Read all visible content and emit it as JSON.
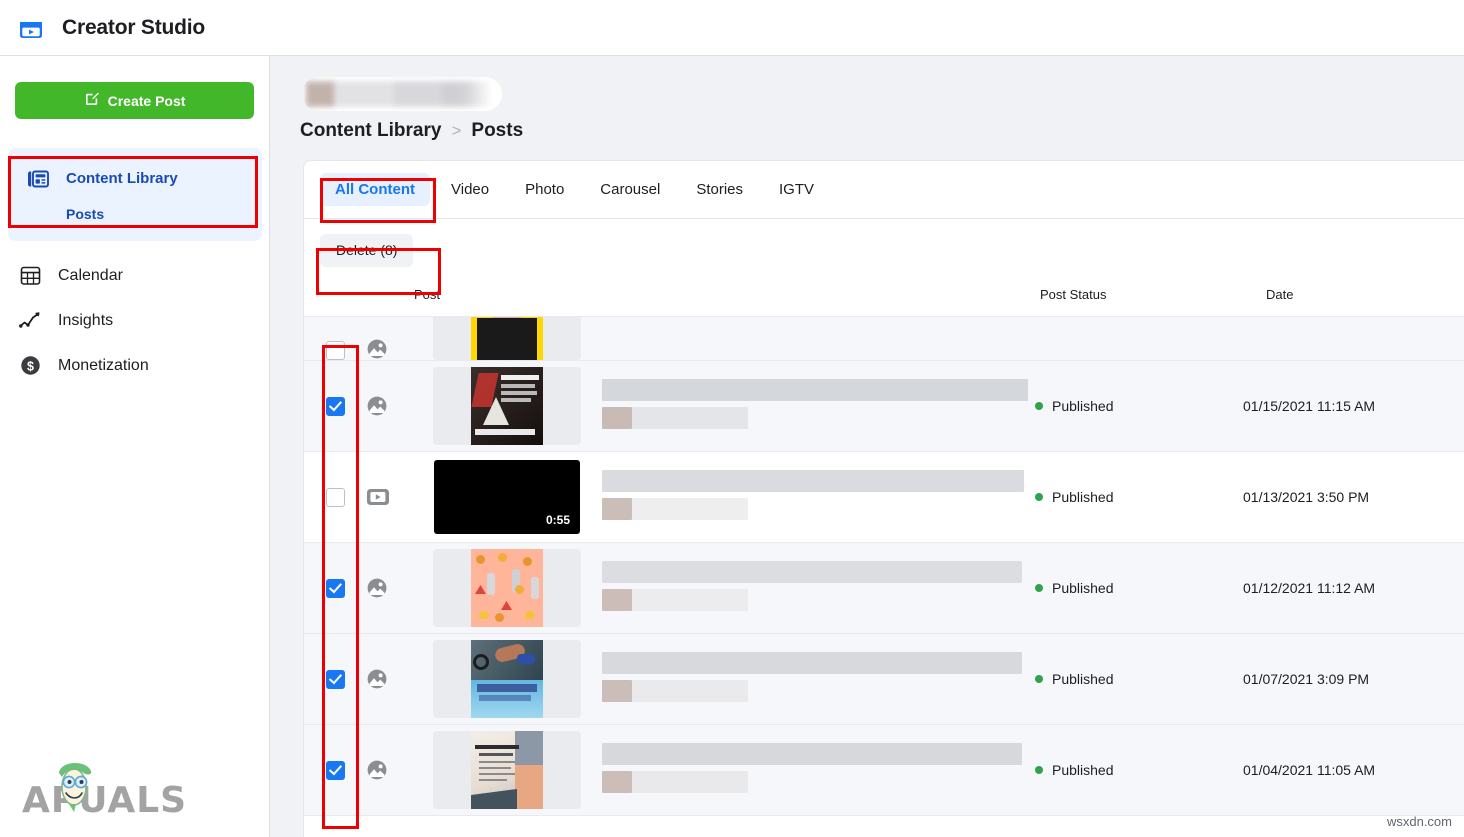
{
  "topbar": {
    "brand_title": "Creator Studio",
    "brand_icon": "clapperboard-play-icon"
  },
  "sidebar": {
    "create_post_label": "Create Post",
    "active_group": {
      "label": "Content Library",
      "icon": "content-library-icon",
      "sub_label": "Posts"
    },
    "items": [
      {
        "label": "Calendar",
        "icon": "calendar-icon"
      },
      {
        "label": "Insights",
        "icon": "insights-chart-icon"
      },
      {
        "label": "Monetization",
        "icon": "dollar-circle-icon"
      }
    ]
  },
  "main": {
    "breadcrumb": {
      "root": "Content Library",
      "separator": ">",
      "current": "Posts"
    },
    "tabs": [
      {
        "label": "All Content",
        "active": true
      },
      {
        "label": "Video",
        "active": false
      },
      {
        "label": "Photo",
        "active": false
      },
      {
        "label": "Carousel",
        "active": false
      },
      {
        "label": "Stories",
        "active": false
      },
      {
        "label": "IGTV",
        "active": false
      }
    ],
    "toolbar": {
      "delete_label": "Delete (8)"
    },
    "table": {
      "columns": {
        "post": "Post",
        "status": "Post Status",
        "date": "Date"
      },
      "rows": [
        {
          "checked": false,
          "partial": true,
          "type_icon": "photo-icon",
          "art": "art-yellow",
          "status": "",
          "date": ""
        },
        {
          "checked": true,
          "partial": false,
          "type_icon": "photo-icon",
          "art": "art-dark",
          "status": "Published",
          "date": "01/15/2021 11:15 AM"
        },
        {
          "checked": false,
          "partial": false,
          "type_icon": "video-play-icon",
          "art": "video",
          "duration": "0:55",
          "status": "Published",
          "date": "01/13/2021 3:50 PM"
        },
        {
          "checked": true,
          "partial": false,
          "type_icon": "photo-icon",
          "art": "art-peach",
          "status": "Published",
          "date": "01/12/2021 11:12 AM"
        },
        {
          "checked": true,
          "partial": false,
          "type_icon": "photo-icon",
          "art": "art-gym",
          "status": "Published",
          "date": "01/07/2021 3:09 PM"
        },
        {
          "checked": true,
          "partial": false,
          "type_icon": "photo-icon",
          "art": "art-doc",
          "status": "Published",
          "date": "01/04/2021 11:05 AM"
        }
      ]
    }
  },
  "watermarks": {
    "appuals": "PUALS",
    "appuals_a": "A",
    "wsxdn": "wsxdn.com"
  },
  "colors": {
    "accent_blue": "#1877f2",
    "nav_active_blue": "#1b4ab5",
    "create_green": "#42b72a",
    "status_green": "#31a24c",
    "annotation_red": "#ee0000"
  }
}
